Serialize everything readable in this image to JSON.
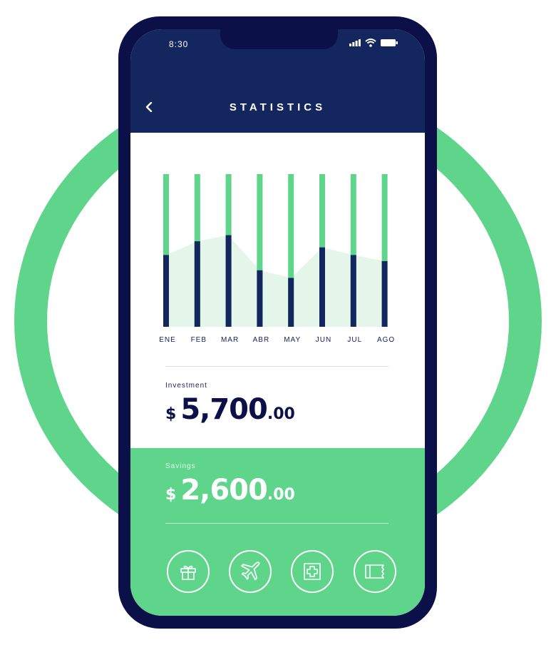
{
  "colors": {
    "accent_green": "#5ed58a",
    "navy_dark": "#0b1148",
    "header_navy": "#13275e",
    "bar_navy": "#13275e",
    "area_fill": "#e4f6ea"
  },
  "status_bar": {
    "time": "8:30",
    "icons": [
      "signal-icon",
      "wifi-icon",
      "battery-icon"
    ]
  },
  "header": {
    "back_icon": "chevron-left-icon",
    "title": "STATISTICS"
  },
  "chart_data": {
    "type": "bar",
    "categories": [
      "ENE",
      "FEB",
      "MAR",
      "ABR",
      "MAY",
      "JUN",
      "JUL",
      "AGO"
    ],
    "values": [
      47,
      56,
      60,
      37,
      32,
      52,
      47,
      43
    ],
    "max": 100,
    "area_values": [
      47,
      56,
      60,
      37,
      32,
      52,
      47,
      43
    ],
    "title": "",
    "xlabel": "",
    "ylabel": "",
    "ylim": [
      0,
      100
    ],
    "grid": false,
    "legend": "none"
  },
  "investment": {
    "label": "Investment",
    "currency": "$",
    "whole": "5,700",
    "decimals": ".00"
  },
  "savings": {
    "label": "Savings",
    "currency": "$",
    "whole": "2,600",
    "decimals": ".00"
  },
  "categories": [
    {
      "icon": "gift-icon"
    },
    {
      "icon": "airplane-icon"
    },
    {
      "icon": "medical-cross-icon"
    },
    {
      "icon": "receipt-icon"
    }
  ]
}
